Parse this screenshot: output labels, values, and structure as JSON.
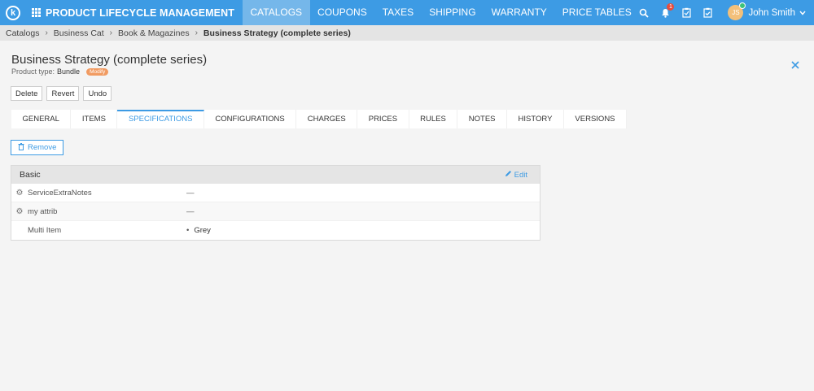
{
  "header": {
    "logo_letter": "k",
    "app_title": "PRODUCT LIFECYCLE MANAGEMENT",
    "nav": [
      "CATALOGS",
      "COUPONS",
      "TAXES",
      "SHIPPING",
      "WARRANTY",
      "PRICE TABLES"
    ],
    "active_nav": "CATALOGS",
    "notification_count": "1",
    "user_initials": "JS",
    "user_name": "John Smith"
  },
  "breadcrumb": [
    "Catalogs",
    "Business Cat",
    "Book & Magazines",
    "Business Strategy (complete series)"
  ],
  "page": {
    "title": "Business Strategy (complete series)",
    "product_type_label": "Product type:",
    "product_type_value": "Bundle",
    "status_badge": "Modify"
  },
  "actions": [
    "Delete",
    "Revert",
    "Undo"
  ],
  "tabs": [
    "GENERAL",
    "ITEMS",
    "SPECIFICATIONS",
    "CONFIGURATIONS",
    "CHARGES",
    "PRICES",
    "RULES",
    "NOTES",
    "HISTORY",
    "VERSIONS"
  ],
  "active_tab": "SPECIFICATIONS",
  "remove_label": "Remove",
  "spec_panel": {
    "title": "Basic",
    "edit_label": "Edit",
    "rows": [
      {
        "attribute": "ServiceExtraNotes",
        "value": "—",
        "has_gear": true
      },
      {
        "attribute": "my attrib",
        "value": "—",
        "has_gear": true
      },
      {
        "attribute": "Multi Item",
        "value": "Grey",
        "has_gear": false,
        "bulleted": true
      }
    ]
  },
  "icons": {
    "search": "search-icon",
    "bell": "bell-icon",
    "clipboard": "clipboard-icon",
    "checklist": "checklist-icon",
    "close": "close-icon",
    "gear": "gear-icon",
    "trash": "trash-icon",
    "pencil": "pencil-icon"
  },
  "colors": {
    "primary": "#3d9be4",
    "active_nav": "#75b7ea",
    "badge_orange": "#f19b62",
    "notification_red": "#e74c3c"
  }
}
